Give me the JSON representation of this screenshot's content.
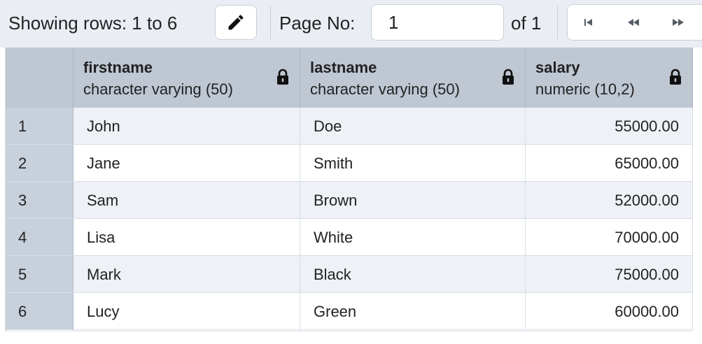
{
  "toolbar": {
    "showing_label": "Showing rows: 1 to 6",
    "edit_icon": "pencil-icon",
    "page_label": "Page No:",
    "page_value": "1",
    "of_label": "of 1",
    "nav_icons": [
      "first-page-icon",
      "previous-page-icon",
      "next-page-icon"
    ]
  },
  "grid": {
    "columns": [
      {
        "name": "firstname",
        "type": "character varying (50)",
        "lock_icon": "lock-icon"
      },
      {
        "name": "lastname",
        "type": "character varying (50)",
        "lock_icon": "lock-icon"
      },
      {
        "name": "salary",
        "type": "numeric (10,2)",
        "lock_icon": "lock-icon"
      }
    ],
    "rows": [
      {
        "num": "1",
        "firstname": "John",
        "lastname": "Doe",
        "salary": "55000.00"
      },
      {
        "num": "2",
        "firstname": "Jane",
        "lastname": "Smith",
        "salary": "65000.00"
      },
      {
        "num": "3",
        "firstname": "Sam",
        "lastname": "Brown",
        "salary": "52000.00"
      },
      {
        "num": "4",
        "firstname": "Lisa",
        "lastname": "White",
        "salary": "70000.00"
      },
      {
        "num": "5",
        "firstname": "Mark",
        "lastname": "Black",
        "salary": "75000.00"
      },
      {
        "num": "6",
        "firstname": "Lucy",
        "lastname": "Green",
        "salary": "60000.00"
      }
    ]
  },
  "colors": {
    "toolbar_bg": "#eaeef4",
    "header_bg": "#bfc7d3",
    "rownum_bg": "#c8d0db",
    "stripe_bg": "#eef1f5"
  }
}
